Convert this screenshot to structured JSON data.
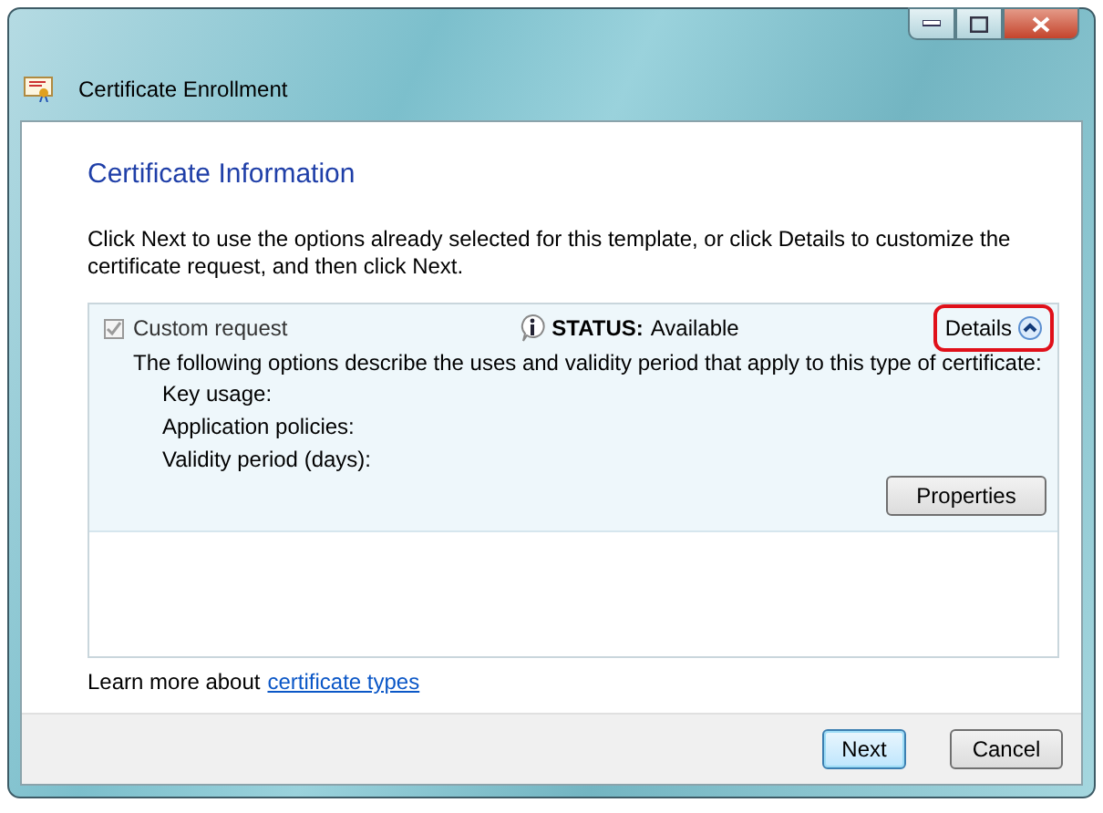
{
  "window": {
    "title": "Certificate Enrollment"
  },
  "heading": "Certificate Information",
  "intro": "Click Next to use the options already selected for this template, or click Details to customize the certificate request, and then click Next.",
  "templates": [
    {
      "name": "Custom request",
      "checked": true,
      "disabled": true,
      "status_label": "STATUS:",
      "status": "Available",
      "details": "Details",
      "expanded": true,
      "highlighted": true,
      "description": "The following options describe the uses and validity period that apply to this type of certificate:",
      "fields": [
        "Key usage:",
        "Application policies:",
        "Validity period (days):"
      ],
      "button": "Properties"
    }
  ],
  "learn_more": {
    "text": "Learn more about",
    "link": "certificate types"
  },
  "buttons": [
    {
      "label": "Next",
      "default": true
    },
    {
      "label": "Cancel",
      "default": false
    }
  ]
}
